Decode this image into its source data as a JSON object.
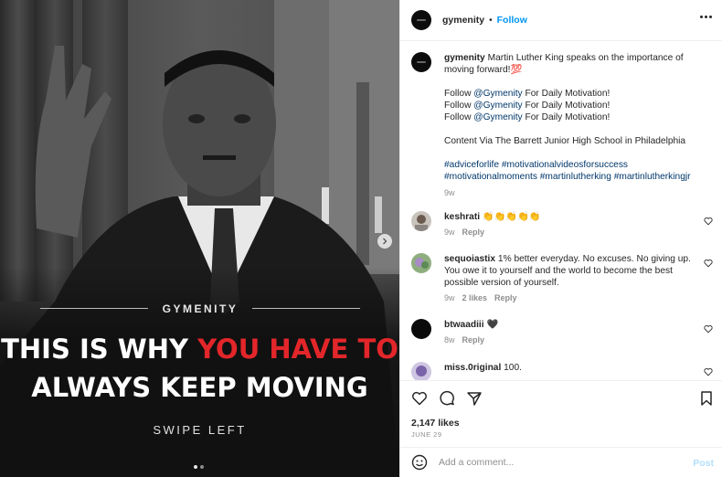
{
  "media": {
    "brand": "GYMENITY",
    "headline_line1_white": "THIS IS WHY ",
    "headline_line1_red": "YOU HAVE TO",
    "headline_line2": "ALWAYS KEEP MOVING",
    "swipe": "SWIPE LEFT",
    "red_color": "#e3262a",
    "carousel_dots": 2,
    "active_dot": 1
  },
  "header": {
    "username": "gymenity",
    "separator": "•",
    "follow_label": "Follow"
  },
  "caption": {
    "username": "gymenity",
    "text": "Martin Luther King speaks on the importance of moving forward!💯",
    "follow_lines": [
      {
        "prefix": "Follow ",
        "mention": "@Gymenity",
        "suffix": " For Daily Motivation!"
      },
      {
        "prefix": "Follow ",
        "mention": "@Gymenity",
        "suffix": " For Daily Motivation!"
      },
      {
        "prefix": "Follow ",
        "mention": "@Gymenity",
        "suffix": " For Daily Motivation!"
      }
    ],
    "credit": "Content Via The Barrett Junior High School in Philadelphia",
    "hashtags_line1": "#adviceforlife #motivationalvideosforsuccess",
    "hashtags_line2": "#motivationalmoments #martinlutherking #martinlutherkingjr",
    "time": "9w"
  },
  "comments": [
    {
      "username": "keshrati",
      "text": "👏👏👏👏👏",
      "time": "9w",
      "likes": "",
      "reply": "Reply"
    },
    {
      "username": "sequoiastix",
      "text": "1% better everyday. No excuses. No giving up. You owe it to yourself and the world to become the best possible version of yourself.",
      "time": "9w",
      "likes": "2 likes",
      "reply": "Reply"
    },
    {
      "username": "btwaadiii",
      "text": "🖤",
      "time": "8w",
      "likes": "",
      "reply": "Reply"
    },
    {
      "username": "miss.0riginal",
      "text": "100.",
      "time": "",
      "likes": "",
      "reply": ""
    }
  ],
  "actions": {
    "likes": "2,147 likes",
    "date": "JUNE 29"
  },
  "add_comment": {
    "placeholder": "Add a comment...",
    "post_label": "Post"
  },
  "colors": {
    "link": "#00376b",
    "follow": "#0095f6",
    "muted": "#8e8e8e"
  }
}
